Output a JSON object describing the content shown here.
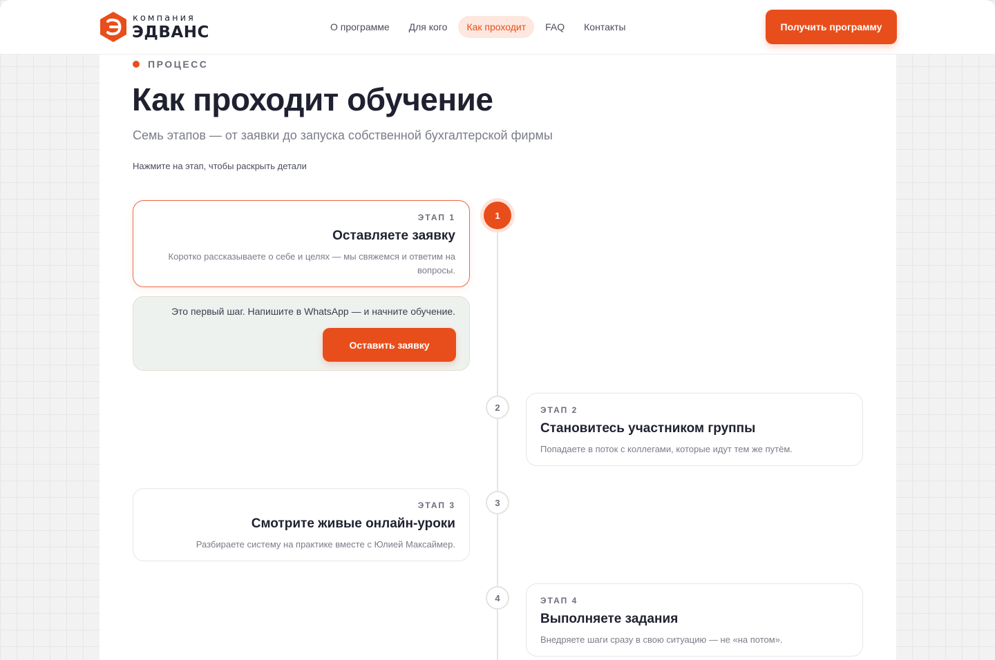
{
  "brand": {
    "logo_letter": "Э",
    "company_small": "компания",
    "company_name": "ЭДВАНС",
    "accent_color": "#e84e1b"
  },
  "nav": {
    "items": [
      {
        "label": "О программе",
        "active": false
      },
      {
        "label": "Для кого",
        "active": false
      },
      {
        "label": "Как проходит",
        "active": true
      },
      {
        "label": "FAQ",
        "active": false
      },
      {
        "label": "Контакты",
        "active": false
      }
    ],
    "cta_label": "Получить программу"
  },
  "section": {
    "eyebrow": "ПРОЦЕСС",
    "title": "Как проходит обучение",
    "subtitle": "Семь этапов — от заявки до запуска собственной бухгалтерской фирмы",
    "hint": "Нажмите на этап, чтобы раскрыть детали"
  },
  "steps": [
    {
      "number": "1",
      "step_label": "ЭТАП 1",
      "title": "Оставляете заявку",
      "description": "Коротко рассказываете о себе и целях — мы свяжемся и ответим на вопросы.",
      "active": true,
      "expanded": {
        "text": "Это первый шаг. Напишите в WhatsApp — и начните обучение.",
        "button_label": "Оставить заявку"
      }
    },
    {
      "number": "2",
      "step_label": "ЭТАП 2",
      "title": "Становитесь участником группы",
      "description": "Попадаете в поток с коллегами, которые идут тем же путём.",
      "active": false
    },
    {
      "number": "3",
      "step_label": "ЭТАП 3",
      "title": "Смотрите живые онлайн-уроки",
      "description": "Разбираете систему на практике вместе с Юлией Максаймер.",
      "active": false
    },
    {
      "number": "4",
      "step_label": "ЭТАП 4",
      "title": "Выполняете задания",
      "description": "Внедряете шаги сразу в свою ситуацию — не «на потом».",
      "active": false
    }
  ]
}
